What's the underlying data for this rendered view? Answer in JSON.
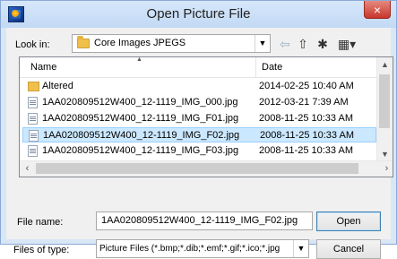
{
  "window": {
    "title": "Open Picture File",
    "close": "×"
  },
  "toolbar": {
    "look_in_label": "Look in:",
    "look_in_value": "Core Images JPEGS",
    "icons": [
      "back-arrow-icon",
      "up-folder-icon",
      "new-folder-icon",
      "view-menu-icon"
    ]
  },
  "list": {
    "columns": {
      "name": "Name",
      "date": "Date"
    },
    "rows": [
      {
        "name": "Altered",
        "date": "2014-02-25 10:40 AM",
        "type": "folder"
      },
      {
        "name": "1AA020809512W400_12-1119_IMG_000.jpg",
        "date": "2012-03-21 7:39 AM",
        "type": "file"
      },
      {
        "name": "1AA020809512W400_12-1119_IMG_F01.jpg",
        "date": "2008-11-25 10:33 AM",
        "type": "file"
      },
      {
        "name": "1AA020809512W400_12-1119_IMG_F02.jpg",
        "date": "2008-11-25 10:33 AM",
        "type": "file",
        "selected": true
      },
      {
        "name": "1AA020809512W400_12-1119_IMG_F03.jpg",
        "date": "2008-11-25 10:33 AM",
        "type": "file"
      }
    ]
  },
  "footer": {
    "file_name_label": "File name:",
    "file_name_value": "1AA020809512W400_12-1119_IMG_F02.jpg",
    "file_type_label": "Files of type:",
    "file_type_value": "Picture Files (*.bmp;*.dib;*.emf;*.gif;*.ico;*.jpg",
    "open_button": "Open",
    "cancel_button": "Cancel"
  }
}
